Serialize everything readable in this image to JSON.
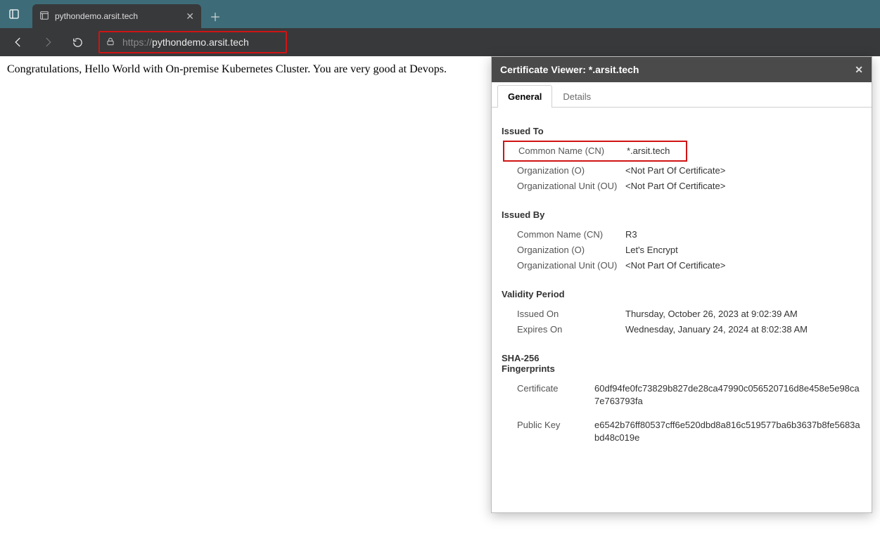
{
  "tab": {
    "title": "pythondemo.arsit.tech"
  },
  "url": {
    "proto": "https://",
    "host": "pythondemo.arsit.tech"
  },
  "page": {
    "text": "Congratulations, Hello World with On-premise Kubernetes Cluster. You are very good at Devops."
  },
  "cert": {
    "titlePrefix": "Certificate Viewer: ",
    "titleDomain": "*.arsit.tech",
    "tabs": {
      "general": "General",
      "details": "Details"
    },
    "issuedTo": {
      "head": "Issued To",
      "cn_k": "Common Name (CN)",
      "cn_v": "*.arsit.tech",
      "o_k": "Organization (O)",
      "o_v": "<Not Part Of Certificate>",
      "ou_k": "Organizational Unit (OU)",
      "ou_v": "<Not Part Of Certificate>"
    },
    "issuedBy": {
      "head": "Issued By",
      "cn_k": "Common Name (CN)",
      "cn_v": "R3",
      "o_k": "Organization (O)",
      "o_v": "Let's Encrypt",
      "ou_k": "Organizational Unit (OU)",
      "ou_v": "<Not Part Of Certificate>"
    },
    "validity": {
      "head": "Validity Period",
      "iss_k": "Issued On",
      "iss_v": "Thursday, October 26, 2023 at 9:02:39 AM",
      "exp_k": "Expires On",
      "exp_v": "Wednesday, January 24, 2024 at 8:02:38 AM"
    },
    "sha": {
      "head1": "SHA-256",
      "head2": "Fingerprints",
      "cert_k": "Certificate",
      "cert_v": "60df94fe0fc73829b827de28ca47990c056520716d8e458e5e98ca7e763793fa",
      "pk_k": "Public Key",
      "pk_v": "e6542b76ff80537cff6e520dbd8a816c519577ba6b3637b8fe5683abd48c019e"
    }
  }
}
